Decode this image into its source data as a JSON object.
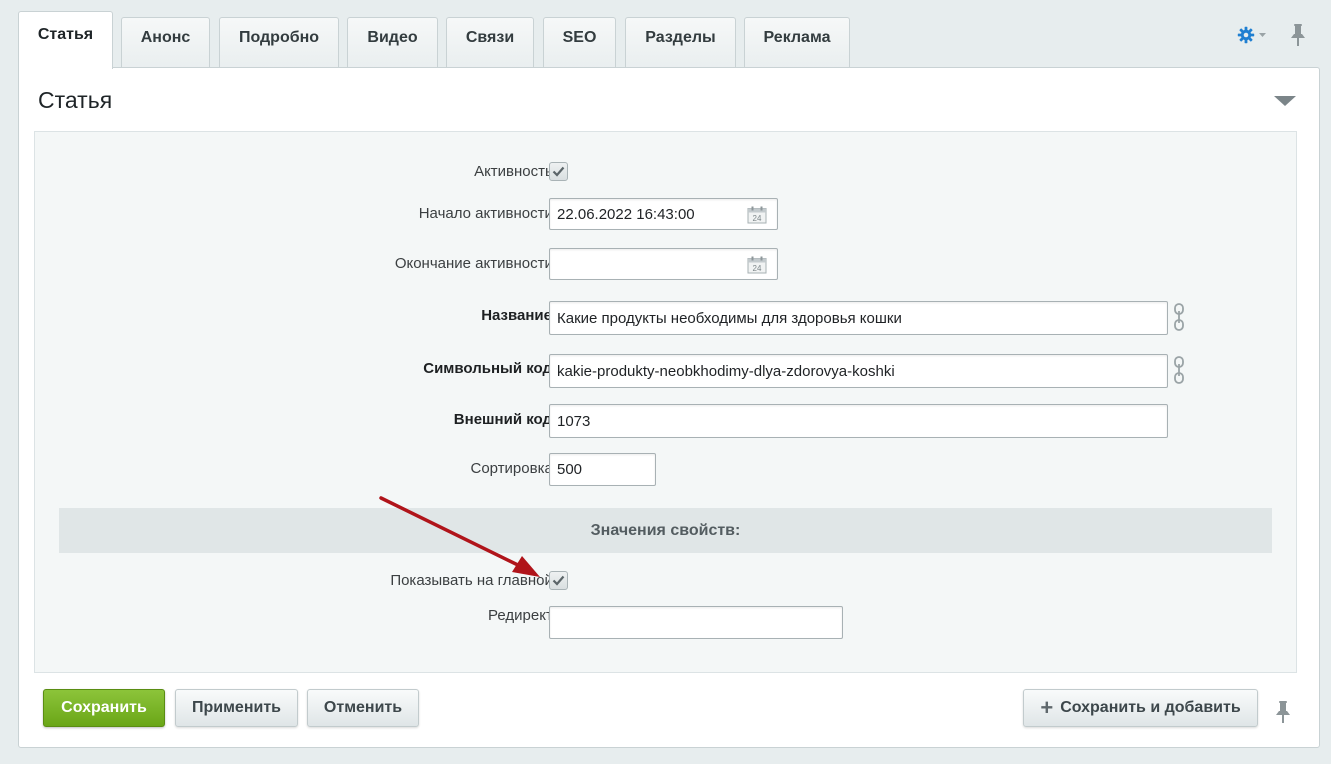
{
  "tabs": [
    {
      "label": "Статья",
      "active": true
    },
    {
      "label": "Анонс"
    },
    {
      "label": "Подробно"
    },
    {
      "label": "Видео"
    },
    {
      "label": "Связи"
    },
    {
      "label": "SEO"
    },
    {
      "label": "Разделы"
    },
    {
      "label": "Реклама"
    }
  ],
  "panel": {
    "title": "Статья"
  },
  "form": {
    "active_label": "Активность:",
    "active_checked": true,
    "start_label": "Начало активности:",
    "start_value": "22.06.2022 16:43:00",
    "end_label": "Окончание активности:",
    "end_value": "",
    "name_label": "Название:",
    "name_value": "Какие продукты необходимы для здоровья кошки",
    "code_label": "Символьный код:",
    "code_value": "kakie-produkty-neobkhodimy-dlya-zdorovya-koshki",
    "xml_label": "Внешний код:",
    "xml_value": "1073",
    "sort_label": "Сортировка:",
    "sort_value": "500",
    "props_header": "Значения свойств:",
    "show_main_label": "Показывать на главной:",
    "show_main_checked": true,
    "redirect_label": "Редирект:",
    "redirect_value": ""
  },
  "buttons": {
    "save": "Сохранить",
    "apply": "Применить",
    "cancel": "Отменить",
    "save_add": "Сохранить и добавить"
  },
  "colors": {
    "accent_green": "#7ab52a",
    "gear_blue": "#1f7fd1",
    "annotation_arrow": "#b0141a"
  },
  "icons": [
    "gear-icon",
    "pin-icon",
    "calendar-icon",
    "link-icon",
    "checkmark-icon",
    "plus-icon",
    "collapse-arrow-icon"
  ]
}
